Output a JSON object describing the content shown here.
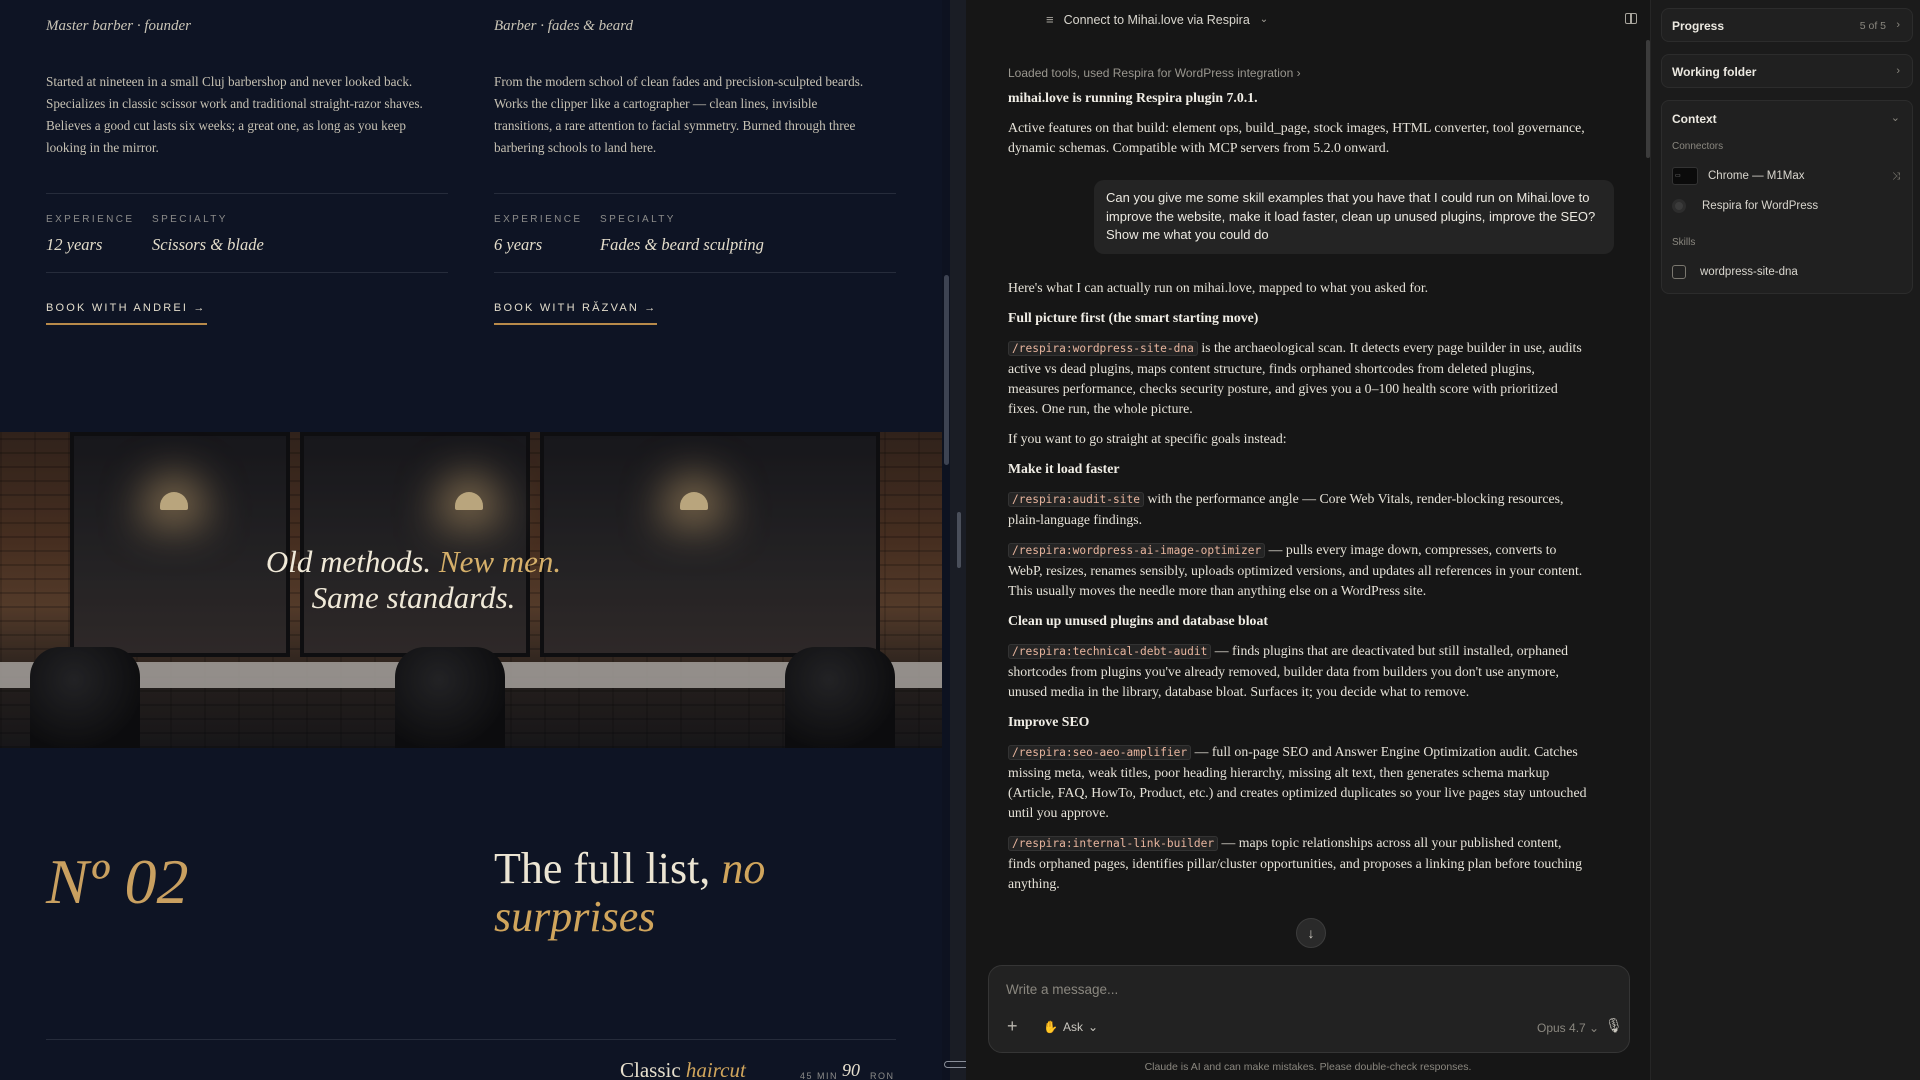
{
  "site": {
    "barbers": [
      {
        "role": "Master barber · founder",
        "bio": "Started at nineteen in a small Cluj barbershop and never looked back. Specializes in classic scissor work and traditional straight-razor shaves. Believes a good cut lasts six weeks; a great one, as long as you keep looking in the mirror.",
        "experience_label": "EXPERIENCE",
        "experience": "12 years",
        "specialty_label": "SPECIALTY",
        "specialty": "Scissors & blade",
        "book": "BOOK WITH ANDREI →"
      },
      {
        "role": "Barber · fades & beard",
        "bio": "From the modern school of clean fades and precision-sculpted beards. Works the clipper like a cartographer — clean lines, invisible transitions, a rare attention to facial symmetry. Burned through three barbering schools to land here.",
        "experience_label": "EXPERIENCE",
        "experience": "6 years",
        "specialty_label": "SPECIALTY",
        "specialty": "Fades & beard sculpting",
        "book": "BOOK WITH RĂZVAN →"
      }
    ],
    "tagline": {
      "l1a": "Old methods.",
      "l1b": "New men.",
      "l2": "Same standards."
    },
    "section_number": "Nº 02",
    "section_title": "The full list,",
    "section_title_em": "no surprises",
    "service": {
      "name": "Classic",
      "name_em": "haircut",
      "duration": "45 MIN",
      "price": "90",
      "currency": "RON"
    }
  },
  "chat": {
    "header": "Connect to Mihai.love via Respira",
    "tools_note": "Loaded tools, used Respira for WordPress integration",
    "intro": "mihai.love is running Respira plugin 7.0.1.",
    "features": "Active features on that build: element ops, build_page, stock images, HTML converter, tool governance, dynamic schemas. Compatible with MCP servers from 5.2.0 onward.",
    "user_message": "Can you give me some skill examples that you have that I could run on Mihai.love to improve the website, make it load faster, clean up unused plugins, improve the SEO? Show me what you could do",
    "reply_intro": "Here's what I can actually run on mihai.love, mapped to what you asked for.",
    "h_full": "Full picture first (the smart starting move)",
    "cmd_dna": "/respira:wordpress-site-dna",
    "txt_dna": "is the archaeological scan. It detects every page builder in use, audits active vs dead plugins, maps content structure, finds orphaned shortcodes from deleted plugins, measures performance, checks security posture, and gives you a 0–100 health score with prioritized fixes. One run, the whole picture.",
    "goals": "If you want to go straight at specific goals instead:",
    "h_fast": "Make it load faster",
    "cmd_audit": "/respira:audit-site",
    "txt_audit": "with the performance angle — Core Web Vitals, render-blocking resources, plain-language findings.",
    "cmd_img": "/respira:wordpress-ai-image-optimizer",
    "txt_img": "— pulls every image down, compresses, converts to WebP, resizes, renames sensibly, uploads optimized versions, and updates all references in your content. This usually moves the needle more than anything else on a WordPress site.",
    "h_clean": "Clean up unused plugins and database bloat",
    "cmd_debt": "/respira:technical-debt-audit",
    "txt_debt": "— finds plugins that are deactivated but still installed, orphaned shortcodes from plugins you've already removed, builder data from builders you don't use anymore, unused media in the library, database bloat. Surfaces it; you decide what to remove.",
    "h_seo": "Improve SEO",
    "cmd_seo": "/respira:seo-aeo-amplifier",
    "txt_seo": "— full on-page SEO and Answer Engine Optimization audit. Catches missing meta, weak titles, poor heading hierarchy, missing alt text, then generates schema markup (Article, FAQ, HowTo, Product, etc.) and creates optimized duplicates so your live pages stay untouched until you approve.",
    "cmd_link": "/respira:internal-link-builder",
    "txt_link": "— maps topic relationships across all your published content, finds orphaned pages, identifies pillar/cluster opportunities, and proposes a linking plan before touching anything.",
    "composer_placeholder": "Write a message...",
    "mode": "Ask",
    "model": "Opus 4.7",
    "disclaimer": "Claude is AI and can make mistakes. Please double-check responses."
  },
  "sidebar": {
    "progress_title": "Progress",
    "progress_count": "5 of 5",
    "working_folder": "Working folder",
    "context_title": "Context",
    "connectors_label": "Connectors",
    "connectors": [
      "Chrome — M1Max",
      "Respira for WordPress"
    ],
    "skills_label": "Skills",
    "skills": [
      "wordpress-site-dna"
    ]
  }
}
